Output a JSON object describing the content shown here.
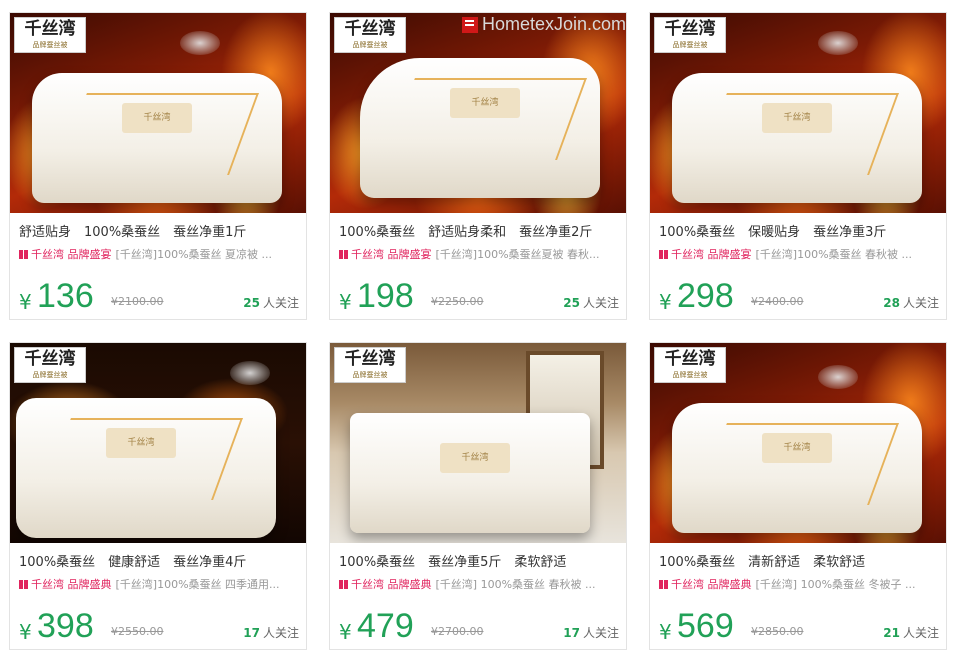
{
  "watermark": {
    "text": "HometexJoin.com"
  },
  "brand": {
    "logo_name": "千丝湾",
    "logo_sub": "品牌蚕丝被"
  },
  "label_text": "千丝湾",
  "currency": "¥",
  "follow_suffix": "人关注",
  "products": [
    {
      "title": "舒适贴身　100%桑蚕丝　蚕丝净重1斤",
      "shop": "千丝湾 品牌盛宴",
      "desc": "[千丝湾]100%桑蚕丝 夏凉被 ...",
      "price": "136",
      "original": "¥2100.00",
      "follows": "25"
    },
    {
      "title": "100%桑蚕丝　舒适贴身柔和　蚕丝净重2斤",
      "shop": "千丝湾 品牌盛宴",
      "desc": "[千丝湾]100%桑蚕丝夏被 春秋...",
      "price": "198",
      "original": "¥2250.00",
      "follows": "25"
    },
    {
      "title": "100%桑蚕丝　保暖贴身　蚕丝净重3斤",
      "shop": "千丝湾 品牌盛宴",
      "desc": "[千丝湾]100%桑蚕丝 春秋被 ...",
      "price": "298",
      "original": "¥2400.00",
      "follows": "28"
    },
    {
      "title": "100%桑蚕丝　健康舒适　蚕丝净重4斤",
      "shop": "千丝湾 品牌盛典",
      "desc": "[千丝湾]100%桑蚕丝 四季通用...",
      "price": "398",
      "original": "¥2550.00",
      "follows": "17"
    },
    {
      "title": "100%桑蚕丝　蚕丝净重5斤　柔软舒适",
      "shop": "千丝湾 品牌盛典",
      "desc": "[千丝湾] 100%桑蚕丝 春秋被 ...",
      "price": "479",
      "original": "¥2700.00",
      "follows": "17"
    },
    {
      "title": "100%桑蚕丝　清新舒适　柔软舒适",
      "shop": "千丝湾 品牌盛典",
      "desc": "[千丝湾] 100%桑蚕丝 冬被子 ...",
      "price": "569",
      "original": "¥2850.00",
      "follows": "21"
    }
  ]
}
